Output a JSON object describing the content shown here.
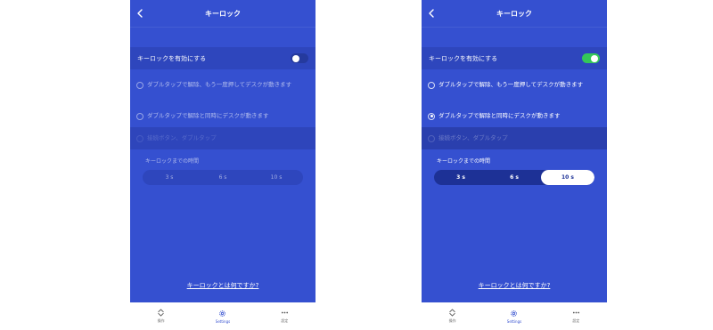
{
  "colors": {
    "background": "#3550d0",
    "row": "#2e46bd",
    "switch_on": "#34c759",
    "tabbar": "#ffffff"
  },
  "screens": [
    {
      "header": {
        "title": "キーロック",
        "back_icon": "chevron-left-icon"
      },
      "toggle": {
        "label": "キーロックを有効にする",
        "on": false
      },
      "options": [
        {
          "label": "ダブルタップで解除、もう一度押してデスクが動きます",
          "selected": false
        },
        {
          "label": "ダブルタップで解除と同時にデスクが動きます",
          "selected": false
        },
        {
          "label": "接続ボタン、ダブルタップ",
          "selected": false
        }
      ],
      "timer": {
        "label": "キーロックまでの時間",
        "segments": [
          "3 s",
          "6 s",
          "10 s"
        ],
        "selected": ""
      },
      "help_link": "キーロックとは何ですか?",
      "tabs": [
        {
          "label": "操作",
          "icon": "up-down-icon",
          "active": false
        },
        {
          "label": "Settings",
          "icon": "gear-icon",
          "active": true
        },
        {
          "label": "設定",
          "icon": "more-dots-icon",
          "active": false
        }
      ]
    },
    {
      "header": {
        "title": "キーロック",
        "back_icon": "chevron-left-icon"
      },
      "toggle": {
        "label": "キーロックを有効にする",
        "on": true
      },
      "options": [
        {
          "label": "ダブルタップで解除、もう一度押してデスクが動きます",
          "selected": false
        },
        {
          "label": "ダブルタップで解除と同時にデスクが動きます",
          "selected": true
        },
        {
          "label": "接続ボタン、ダブルタップ",
          "selected": false
        }
      ],
      "timer": {
        "label": "キーロックまでの時間",
        "segments": [
          "3 s",
          "6 s",
          "10 s"
        ],
        "selected": "10 s"
      },
      "help_link": "キーロックとは何ですか?",
      "tabs": [
        {
          "label": "操作",
          "icon": "up-down-icon",
          "active": false
        },
        {
          "label": "Settings",
          "icon": "gear-icon",
          "active": true
        },
        {
          "label": "設定",
          "icon": "more-dots-icon",
          "active": false
        }
      ]
    }
  ]
}
